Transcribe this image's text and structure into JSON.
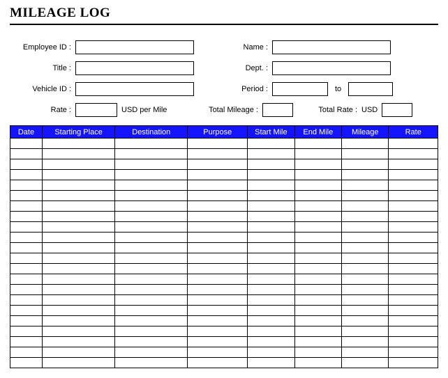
{
  "title": "MILEAGE LOG",
  "form": {
    "employee_id_label": "Employee ID :",
    "employee_id_value": "",
    "name_label": "Name :",
    "name_value": "",
    "title_label": "Title :",
    "title_value": "",
    "dept_label": "Dept. :",
    "dept_value": "",
    "vehicle_id_label": "Vehicle ID :",
    "vehicle_id_value": "",
    "period_label": "Period :",
    "period_from_value": "",
    "period_to_word": "to",
    "period_to_value": "",
    "rate_label": "Rate :",
    "rate_value": "",
    "rate_suffix": "USD per Mile",
    "total_mileage_label": "Total Mileage :",
    "total_mileage_value": "",
    "total_rate_label": "Total Rate :",
    "total_rate_currency": "USD",
    "total_rate_value": ""
  },
  "table": {
    "headers": {
      "date": "Date",
      "starting_place": "Starting Place",
      "destination": "Destination",
      "purpose": "Purpose",
      "start_mile": "Start Mile",
      "end_mile": "End Mile",
      "mileage": "Mileage",
      "rate": "Rate"
    },
    "row_count": 22
  }
}
